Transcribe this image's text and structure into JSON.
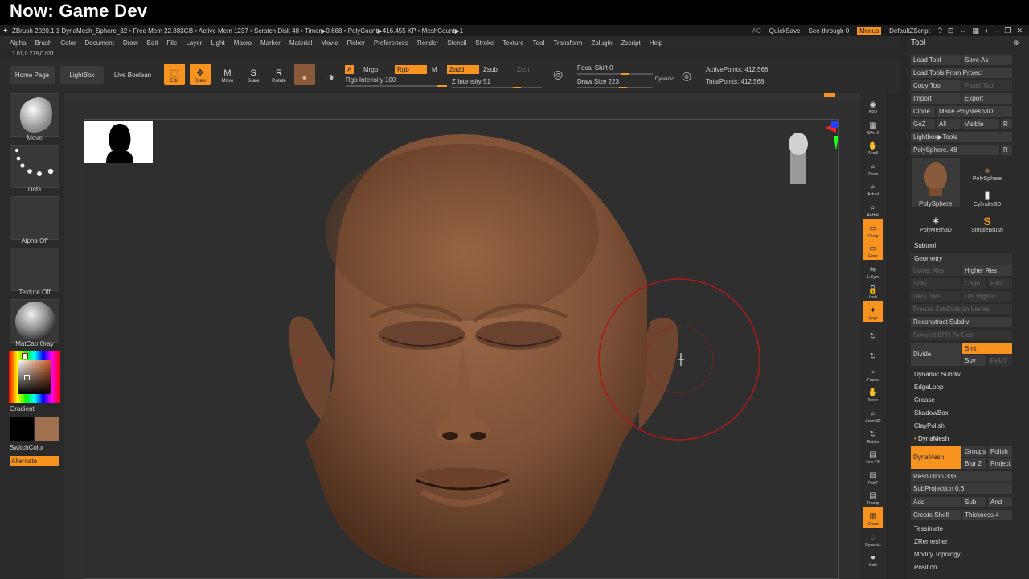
{
  "overlay": {
    "banner": "Now: Game Dev"
  },
  "titlebar": {
    "info": "ZBrush 2020.1.1   DynaMesh_Sphere_32  • Free Mem 22.883GB • Active Mem 1237 • Scratch Disk 48 • Timer▶0.668 • PolyCount▶416.455 KP • MeshCount▶1",
    "ac": "AC",
    "quicksave": "QuickSave",
    "seethrough": "See-through  0",
    "menus": "Menus",
    "script": "DefaultZScript"
  },
  "menubar": {
    "items": [
      "Alpha",
      "Brush",
      "Color",
      "Document",
      "Draw",
      "Edit",
      "File",
      "Layer",
      "Light",
      "Macro",
      "Marker",
      "Material",
      "Movie",
      "Picker",
      "Preferences",
      "Render",
      "Stencil",
      "Stroke",
      "Texture",
      "Tool",
      "Transform",
      "Zplugin",
      "Zscript",
      "Help"
    ]
  },
  "version": "1.01,0.279,0.031",
  "shelf": {
    "home": "Home Page",
    "lightbox": "LightBox",
    "liveboolean": "Live Boolean",
    "edit": "Edit",
    "draw": "Draw",
    "move": "Move",
    "scale": "Scale",
    "rotate": "Rotate",
    "a": "A",
    "mrgb": "Mrgb",
    "rgb": "Rgb",
    "m": "M",
    "zadd": "Zadd",
    "zsub": "Zsub",
    "zcut": "Zcut",
    "rgb_intensity": "Rgb Intensity 100",
    "z_intensity": "Z Intensity 51",
    "focal_shift": "Focal Shift 0",
    "draw_size": "Draw Size 223",
    "dynamic": "Dynamic",
    "active_points": "ActivePoints: 412,568",
    "total_points": "TotalPoints: 412,568"
  },
  "lefttray": {
    "brush": "Move",
    "stroke": "Dots",
    "alpha": "Alpha Off",
    "texture": "Texture Off",
    "material": "MatCap Gray",
    "gradient": "Gradient",
    "switchcolor": "SwitchColor",
    "alternate": "Alternate",
    "main_color": "#000000",
    "secondary_color": "#a07050"
  },
  "rightshelf": {
    "items": [
      "BPR",
      "SPix 3",
      "Scroll",
      "Zoom",
      "Actual",
      "AAHalf",
      "Persp",
      "Floor",
      "L.Sym",
      "Lock",
      "Qxyz",
      "",
      "",
      "Frame",
      "Move",
      "Zoom3D",
      "Rotate",
      "Line Fill",
      "PolyF",
      "Transp",
      "Ghost",
      "Dynamic",
      "Solo"
    ]
  },
  "palette": {
    "title": "Tool",
    "load_tool": "Load Tool",
    "save_as": "Save As",
    "load_from_project": "Load Tools From Project",
    "copy_tool": "Copy Tool",
    "paste_tool": "Paste Tool",
    "import": "Import",
    "export": "Export",
    "clone": "Clone",
    "make_polymesh": "Make PolyMesh3D",
    "goz": "GoZ",
    "all": "All",
    "visible": "Visible",
    "r": "R",
    "lightbox_tools": "Lightbox▶Tools",
    "polysphere_slider": "PolySphere. 48",
    "tiles": [
      "PolySphere",
      "PolySphere",
      "Cylinder3D",
      "PolyMesh3D",
      "SimpleBrush"
    ],
    "subtool": "Subtool",
    "geometry": "Geometry",
    "lower_res": "Lower Res",
    "higher_res": "Higher Res",
    "sdiv": "SDiv",
    "cage": "Cage",
    "rstr": "Rstr",
    "del_lower": "Del Lower",
    "del_higher": "Del Higher",
    "freeze": "Freeze SubDivision Levels",
    "reconstruct": "Reconstruct Subdiv",
    "convert_bpr": "Convert BPR To Geo",
    "divide": "Divide",
    "smt": "Smt",
    "suv": "Suv",
    "reuv": "ReUV",
    "dynamic_subdiv": "Dynamic Subdiv",
    "edgeloop": "EdgeLoop",
    "crease": "Crease",
    "shadowbox": "ShadowBox",
    "claypolish": "ClayPolish",
    "dynamesh_header": "DynaMesh",
    "dynamesh_btn": "DynaMesh",
    "groups": "Groups",
    "polish": "Polish",
    "blur": "Blur 2",
    "project": "Project",
    "resolution": "Resolution 336",
    "subprojection": "SubProjection 0.6",
    "add": "Add",
    "sub": "Sub",
    "and": "And",
    "create_shell": "Create Shell",
    "thickness": "Thickness 4",
    "tessimate": "Tessimate",
    "zremesher": "ZRemesher",
    "modify_topology": "Modify Topology",
    "position": "Position"
  },
  "colors": {
    "accent": "#f7931e",
    "skin": "#8a5a3c",
    "brush_ring": "#b01818"
  }
}
